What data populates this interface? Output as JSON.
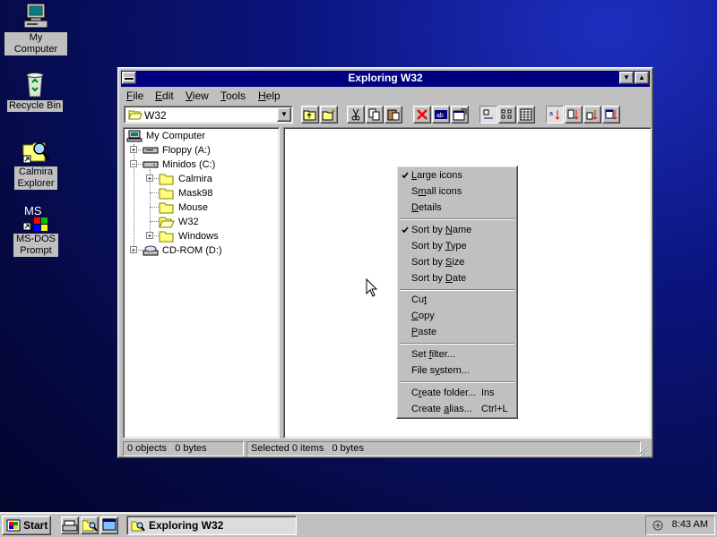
{
  "desktop": {
    "icons": [
      {
        "label": "My Computer"
      },
      {
        "label": "Recycle Bin"
      },
      {
        "label_line1": "Calmira",
        "label_line2": "Explorer"
      },
      {
        "label_line1": "MS-DOS",
        "label_line2": "Prompt"
      }
    ]
  },
  "window": {
    "title": "Exploring W32",
    "menus": [
      "File",
      "Edit",
      "View",
      "Tools",
      "Help"
    ],
    "menu_accel": [
      "F",
      "E",
      "V",
      "T",
      "H"
    ],
    "menu_rest": [
      "ile",
      "dit",
      "iew",
      "ools",
      "elp"
    ],
    "address_value": "W32"
  },
  "tree": {
    "items": [
      {
        "label": "My Computer"
      },
      {
        "label": "Floppy (A:)"
      },
      {
        "label": "Minidos (C:)"
      },
      {
        "label": "Calmira"
      },
      {
        "label": "Mask98"
      },
      {
        "label": "Mouse"
      },
      {
        "label": "W32"
      },
      {
        "label": "Windows"
      },
      {
        "label": "CD-ROM (D:)"
      }
    ]
  },
  "status": {
    "left": "0 objects   0 bytes",
    "right": "Selected 0 items   0 bytes"
  },
  "context_menu": {
    "items": [
      {
        "pre": "",
        "acc": "L",
        "post": "arge icons",
        "checked": true
      },
      {
        "pre": "S",
        "acc": "m",
        "post": "all icons"
      },
      {
        "pre": "",
        "acc": "D",
        "post": "etails"
      },
      {
        "pre": "Sort by ",
        "acc": "N",
        "post": "ame",
        "checked": true
      },
      {
        "pre": "Sort by ",
        "acc": "T",
        "post": "ype"
      },
      {
        "pre": "Sort by ",
        "acc": "S",
        "post": "ize"
      },
      {
        "pre": "Sort by ",
        "acc": "D",
        "post": "ate"
      },
      {
        "pre": "Cu",
        "acc": "t",
        "post": ""
      },
      {
        "pre": "",
        "acc": "C",
        "post": "opy"
      },
      {
        "pre": "",
        "acc": "P",
        "post": "aste"
      },
      {
        "pre": "Set ",
        "acc": "f",
        "post": "ilter..."
      },
      {
        "pre": "File s",
        "acc": "y",
        "post": "stem..."
      },
      {
        "pre": "C",
        "acc": "r",
        "post": "eate folder...",
        "shortcut": "Ins"
      },
      {
        "pre": "Create ",
        "acc": "a",
        "post": "lias...",
        "shortcut": "Ctrl+L"
      }
    ]
  },
  "taskbar": {
    "start_label": "Start",
    "task_label": "Exploring W32",
    "clock": "8:43 AM"
  }
}
